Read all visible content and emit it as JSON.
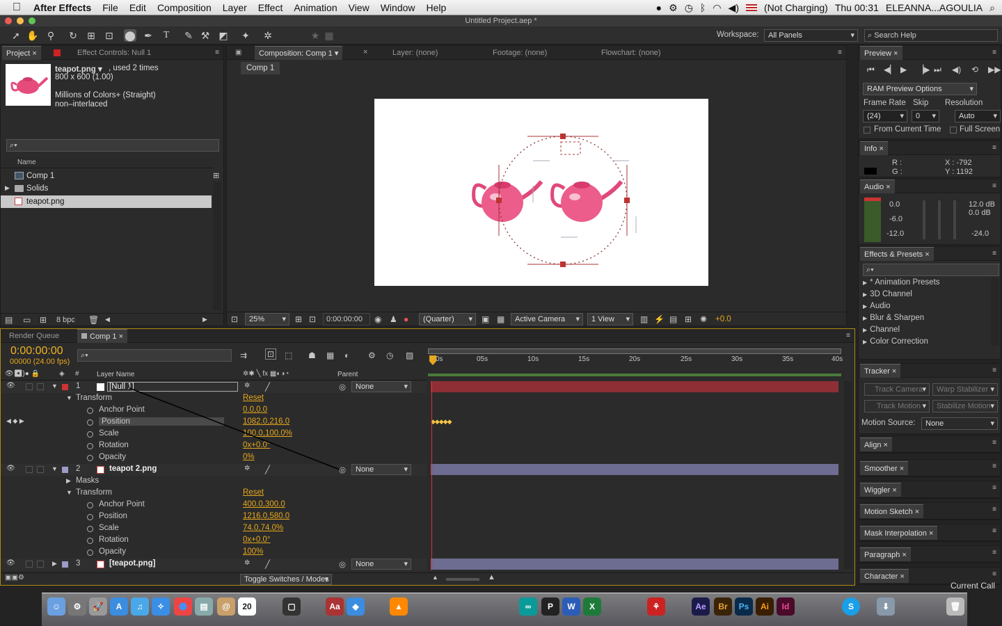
{
  "menubar": {
    "app": "After Effects",
    "items": [
      "File",
      "Edit",
      "Composition",
      "Layer",
      "Effect",
      "Animation",
      "View",
      "Window",
      "Help"
    ],
    "battery": "(Not Charging)",
    "clock": "Thu 00:31",
    "user": "ELEANNA...AGOULIA"
  },
  "window": {
    "title": "Untitled Project.aep *"
  },
  "toolbar": {
    "workspace_label": "Workspace:",
    "workspace_value": "All Panels",
    "search_help": "Search Help"
  },
  "project": {
    "tab": "Project",
    "effect_tab": "Effect Controls: Null 1",
    "file_name": "teapot.png ▾",
    "usage": ", used 2 times",
    "dims": "800 x 600 (1.00)",
    "colors": "Millions of Colors+ (Straight)",
    "interlace": "non–interlaced",
    "col_name": "Name",
    "items": [
      "Comp 1",
      "Solids",
      "teapot.png"
    ],
    "bpc": "8 bpc"
  },
  "composition": {
    "tab": "Composition: Comp 1",
    "layer_tab": "Layer: (none)",
    "footage_tab": "Footage: (none)",
    "flowchart_tab": "Flowchart: (none)",
    "breadcrumb": "Comp 1",
    "zoom": "25%",
    "timecode": "0:00:00:00",
    "resolution": "(Quarter)",
    "camera": "Active Camera",
    "view": "1 View",
    "exposure": "+0.0"
  },
  "preview": {
    "tab": "Preview",
    "ram": "RAM Preview Options",
    "frame_rate_label": "Frame Rate",
    "skip_label": "Skip",
    "resolution_label": "Resolution",
    "frame_rate": "(24)",
    "skip": "0",
    "resolution": "Auto",
    "from_current": "From Current Time",
    "full_screen": "Full Screen"
  },
  "info": {
    "tab": "Info",
    "r": "R :",
    "g": "G :",
    "x": "X : -792",
    "y": "Y : 1192"
  },
  "audio": {
    "tab": "Audio",
    "left": [
      "0.0",
      "-6.0",
      "-12.0"
    ],
    "right": [
      "12.0 dB",
      "0.0 dB",
      "-24.0"
    ]
  },
  "effects": {
    "tab": "Effects & Presets",
    "items": [
      "* Animation Presets",
      "3D Channel",
      "Audio",
      "Blur & Sharpen",
      "Channel",
      "Color Correction"
    ]
  },
  "tracker": {
    "tab": "Tracker",
    "track_camera": "Track Camera",
    "warp": "Warp Stabilizer",
    "track_motion": "Track Motion",
    "stabilize": "Stabilize Motion",
    "motion_source_label": "Motion Source:",
    "motion_source": "None"
  },
  "side_panels": [
    "Align",
    "Smoother",
    "Wiggler",
    "Motion Sketch",
    "Mask Interpolation",
    "Paragraph",
    "Character"
  ],
  "current_call": "Current Call",
  "timeline": {
    "render_tab": "Render Queue",
    "comp_tab": "Comp 1",
    "timecode": "0:00:00:00",
    "frames": "00000 (24.00 fps)",
    "layer_name_col": "Layer Name",
    "parent_col": "Parent",
    "toggle": "Toggle Switches / Modes",
    "ruler": [
      "0s",
      "05s",
      "10s",
      "15s",
      "20s",
      "25s",
      "30s",
      "35s",
      "40s"
    ],
    "layers": [
      {
        "num": "1",
        "name": "[Null 1]",
        "parent": "None",
        "color": "#b23a3a"
      },
      {
        "num": "2",
        "name": "teapot 2.png",
        "parent": "None",
        "color": "#8a8ab0"
      },
      {
        "num": "3",
        "name": "[teapot.png]",
        "parent": "None",
        "color": "#8a8ab0"
      }
    ],
    "props1": [
      [
        "Transform",
        "Reset"
      ],
      [
        "Anchor Point",
        "0.0,0.0"
      ],
      [
        "Position",
        "1082.0,216.0"
      ],
      [
        "Scale",
        "100.0,100.0%"
      ],
      [
        "Rotation",
        "0x+0.0°"
      ],
      [
        "Opacity",
        "0%"
      ]
    ],
    "props2": [
      [
        "Masks",
        ""
      ],
      [
        "Transform",
        "Reset"
      ],
      [
        "Anchor Point",
        "400.0,300.0"
      ],
      [
        "Position",
        "1216.0,580.0"
      ],
      [
        "Scale",
        "74.0,74.0%"
      ],
      [
        "Rotation",
        "0x+0.0°"
      ],
      [
        "Opacity",
        "100%"
      ]
    ]
  },
  "dock": {
    "date": "20",
    "labels": [
      "P",
      "W",
      "X",
      "Ae",
      "Br",
      "Ps",
      "Ai",
      "Id",
      "S"
    ]
  }
}
